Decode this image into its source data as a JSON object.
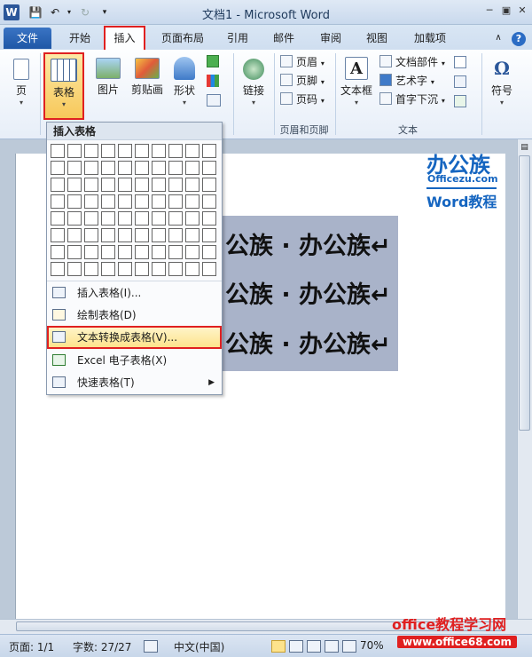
{
  "window": {
    "title": "文档1 - Microsoft Word",
    "app_icon": "W"
  },
  "tabs": {
    "file": "文件",
    "home": "开始",
    "insert": "插入",
    "layout": "页面布局",
    "references": "引用",
    "mailings": "邮件",
    "review": "审阅",
    "view": "视图",
    "addins": "加载项"
  },
  "ribbon": {
    "pages_label": "页",
    "table_label": "表格",
    "picture_label": "图片",
    "clipart_label": "剪贴画",
    "shapes_label": "形状",
    "link_label": "链接",
    "header_label": "页眉",
    "footer_label": "页脚",
    "pagenum_label": "页码",
    "header_footer_group": "页眉和页脚",
    "textbox_label": "文本框",
    "quickparts_label": "文档部件",
    "wordart_label": "艺术字",
    "dropcap_label": "首字下沉",
    "text_group": "文本",
    "symbol_label": "符号"
  },
  "dropdown": {
    "header": "插入表格",
    "grid_cols": 10,
    "grid_rows": 8,
    "items": [
      {
        "label": "插入表格(I)..."
      },
      {
        "label": "绘制表格(D)"
      },
      {
        "label": "文本转换成表格(V)..."
      },
      {
        "label": "Excel 电子表格(X)"
      },
      {
        "label": "快速表格(T)"
      }
    ]
  },
  "document": {
    "lines": [
      "公族 · 办公族↵",
      "公族 · 办公族↵",
      "公族 · 办公族↵"
    ]
  },
  "logo": {
    "top": "办公族",
    "mid": "Officezu.com",
    "bottom": "Word教程"
  },
  "statusbar": {
    "page": "页面: 1/1",
    "words": "字数: 27/27",
    "lang": "中文(中国)",
    "zoom": "70%"
  },
  "watermark": {
    "text": "office教程学习网",
    "url": "www.office68.com"
  }
}
